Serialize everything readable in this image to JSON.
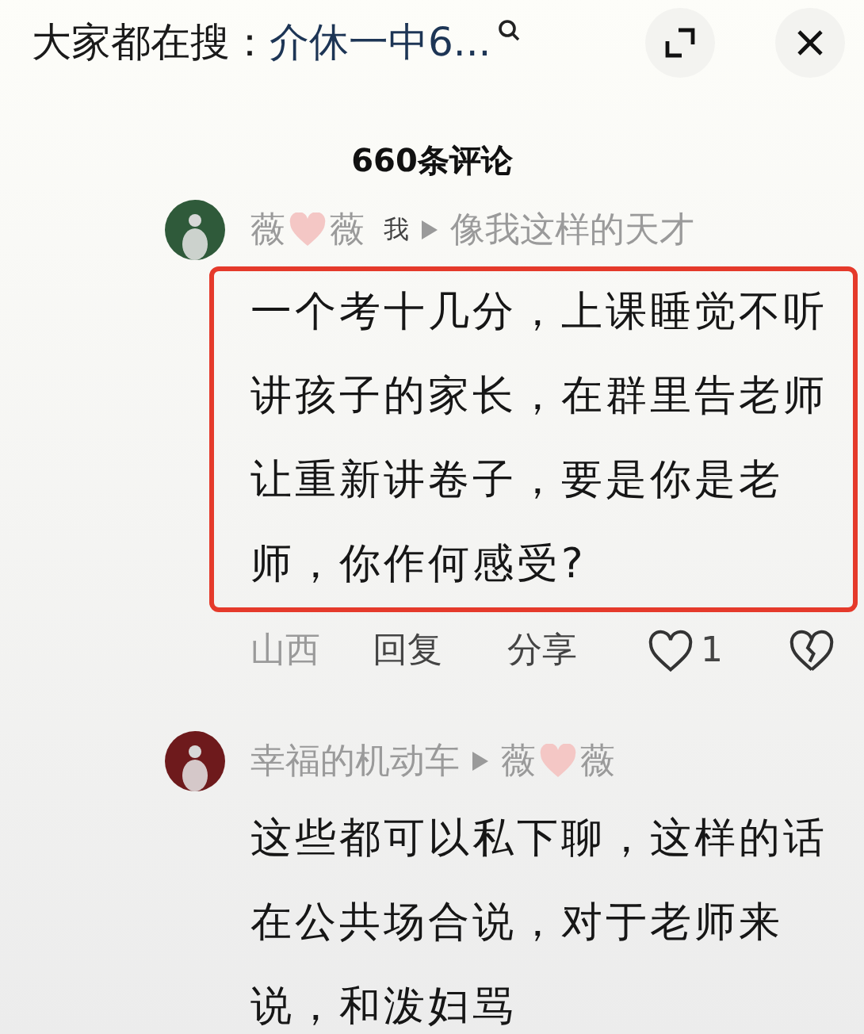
{
  "header": {
    "prefix": "大家都在搜：",
    "query": "介休一中6..."
  },
  "comment_count": "660条评论",
  "comments": [
    {
      "name_before": "薇",
      "name_after": "薇",
      "is_me": true,
      "me_tag": "我",
      "reply_to": "像我这样的天才",
      "text": "一个考十几分，上课睡觉不听讲孩子的家长，在群里告老师让重新讲卷子，要是你是老师，你作何感受?",
      "highlighted": true,
      "location": "山西",
      "reply": "回复",
      "share": "分享",
      "likes": "1"
    },
    {
      "name": "幸福的机动车",
      "reply_to_before": "薇",
      "reply_to_after": "薇",
      "is_me": false,
      "text": "这些都可以私下聊，这样的话在公共场合说，对于老师来说，和泼妇骂",
      "highlighted": false
    }
  ]
}
